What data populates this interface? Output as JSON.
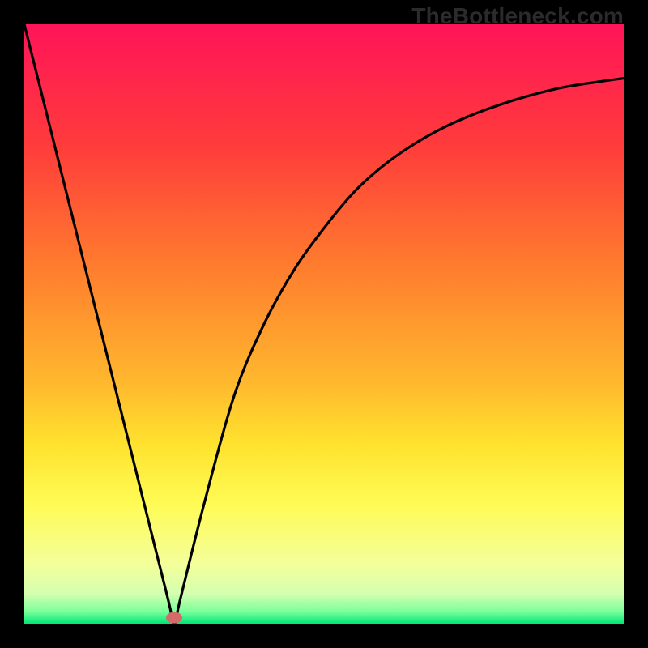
{
  "watermark": "TheBottleneck.com",
  "chart_data": {
    "type": "line",
    "title": "",
    "xlabel": "",
    "ylabel": "",
    "xlim": [
      0,
      100
    ],
    "ylim": [
      0,
      100
    ],
    "grid": false,
    "legend": false,
    "series": [
      {
        "name": "curve",
        "x": [
          0,
          5,
          10,
          15,
          20,
          24,
          25,
          26,
          30,
          35,
          40,
          45,
          50,
          55,
          60,
          65,
          70,
          75,
          80,
          85,
          90,
          95,
          100
        ],
        "y": [
          100,
          80,
          60,
          40,
          20,
          4,
          0,
          4,
          20,
          38,
          50,
          59,
          66,
          72,
          76.5,
          80,
          82.8,
          85,
          86.8,
          88.3,
          89.5,
          90.3,
          91
        ]
      }
    ],
    "marker": {
      "x": 25,
      "y": 1,
      "color": "#d46a6a"
    },
    "background_gradient": {
      "stops": [
        {
          "offset": 0.0,
          "color": "#ff1459"
        },
        {
          "offset": 0.2,
          "color": "#ff3b3b"
        },
        {
          "offset": 0.4,
          "color": "#ff7b2e"
        },
        {
          "offset": 0.6,
          "color": "#ffb92e"
        },
        {
          "offset": 0.7,
          "color": "#ffe22e"
        },
        {
          "offset": 0.8,
          "color": "#fffb55"
        },
        {
          "offset": 0.9,
          "color": "#f4ff9a"
        },
        {
          "offset": 0.95,
          "color": "#d4ffb0"
        },
        {
          "offset": 0.98,
          "color": "#7aff9a"
        },
        {
          "offset": 1.0,
          "color": "#00e676"
        }
      ]
    }
  }
}
